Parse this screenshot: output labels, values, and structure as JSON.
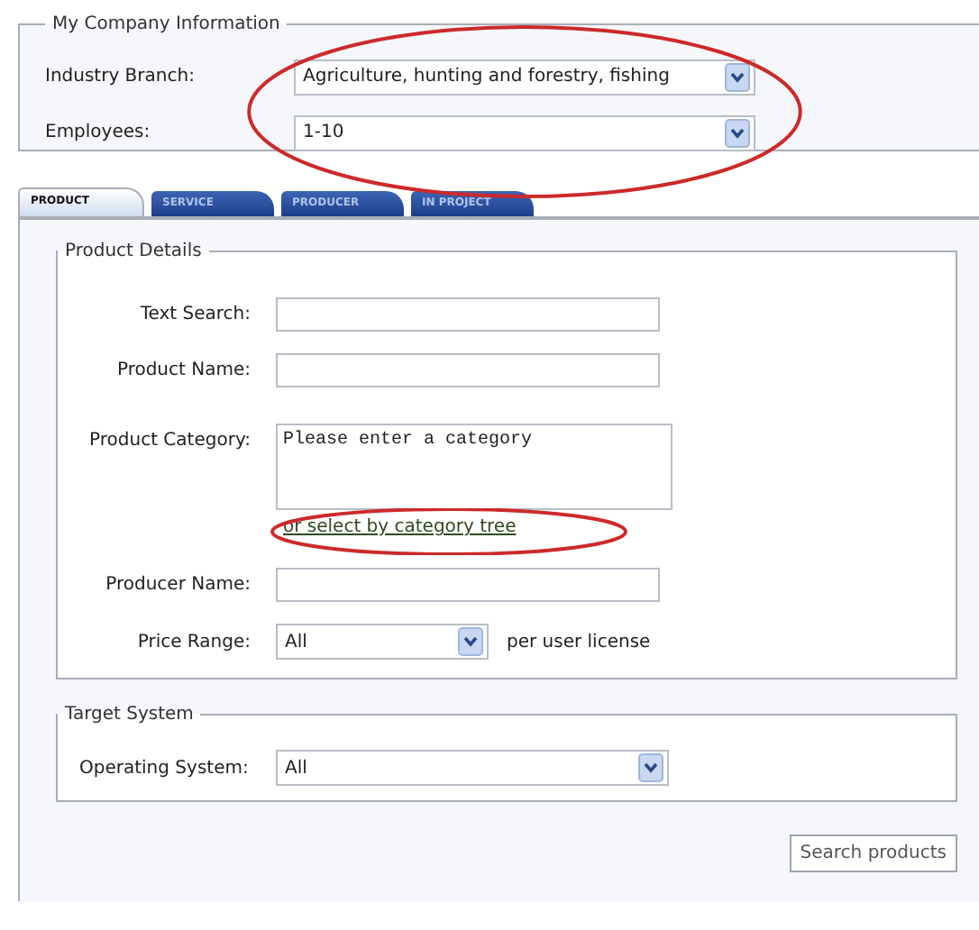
{
  "company": {
    "legend": "My Company Information",
    "circled": true,
    "fields": [
      {
        "label": "Industry Branch:",
        "value": "Agriculture, hunting and forestry, fishing"
      },
      {
        "label": "Employees:",
        "value": "1-10"
      }
    ]
  },
  "tabs": [
    {
      "label": "PRODUCT",
      "selected": true
    },
    {
      "label": "SERVICE",
      "selected": false
    },
    {
      "label": "PRODUCER",
      "selected": false
    },
    {
      "label": "IN PROJECT",
      "selected": false
    }
  ],
  "product_details": {
    "legend": "Product Details",
    "text_search": {
      "label": "Text Search:"
    },
    "product_name": {
      "label": "Product Name:"
    },
    "product_category": {
      "label": "Product Category:",
      "value": "Please enter a category"
    },
    "category_link": {
      "text": "or select by category tree",
      "circled": true
    },
    "producer_name": {
      "label": "Producer Name:"
    },
    "price_range": {
      "label": "Price Range:",
      "value": "All",
      "suffix": "per user license"
    }
  },
  "target_system": {
    "legend": "Target System",
    "operating_system": {
      "label": "Operating System:",
      "value": "All"
    }
  },
  "search_button": "Search products"
}
